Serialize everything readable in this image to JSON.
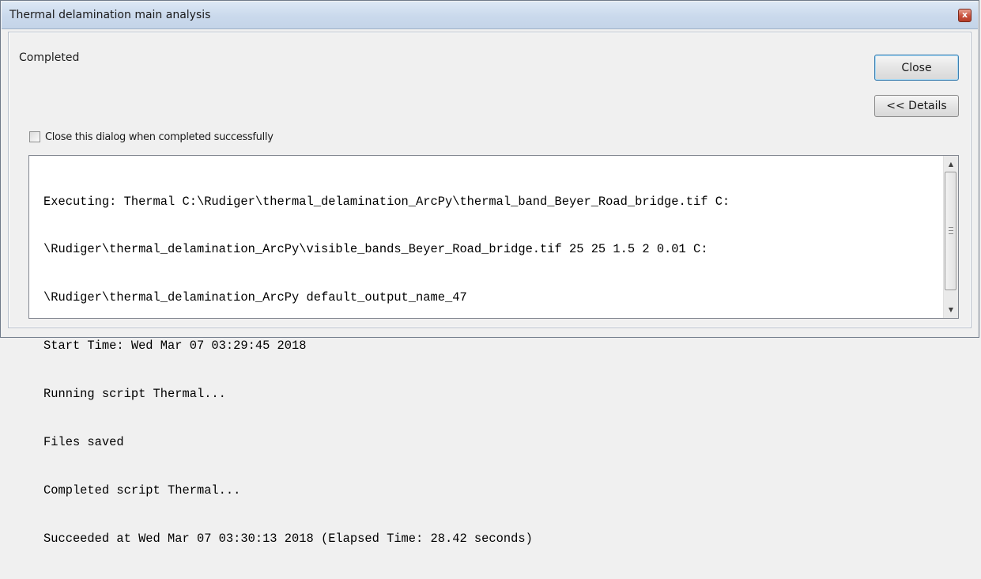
{
  "window": {
    "title": "Thermal delamination main analysis",
    "close_glyph": "x"
  },
  "status": "Completed",
  "buttons": {
    "close_label": "Close",
    "details_label": "<< Details"
  },
  "checkbox": {
    "label": "Close this dialog when completed successfully",
    "checked": false
  },
  "log": {
    "lines": [
      "Executing: Thermal C:\\Rudiger\\thermal_delamination_ArcPy\\thermal_band_Beyer_Road_bridge.tif C:",
      "\\Rudiger\\thermal_delamination_ArcPy\\visible_bands_Beyer_Road_bridge.tif 25 25 1.5 2 0.01 C:",
      "\\Rudiger\\thermal_delamination_ArcPy default_output_name_47",
      "Start Time: Wed Mar 07 03:29:45 2018",
      "Running script Thermal...",
      "Files saved",
      "Completed script Thermal...",
      "Succeeded at Wed Mar 07 03:30:13 2018 (Elapsed Time: 28.42 seconds)"
    ]
  },
  "scrollbar": {
    "up_glyph": "▲",
    "down_glyph": "▼"
  }
}
